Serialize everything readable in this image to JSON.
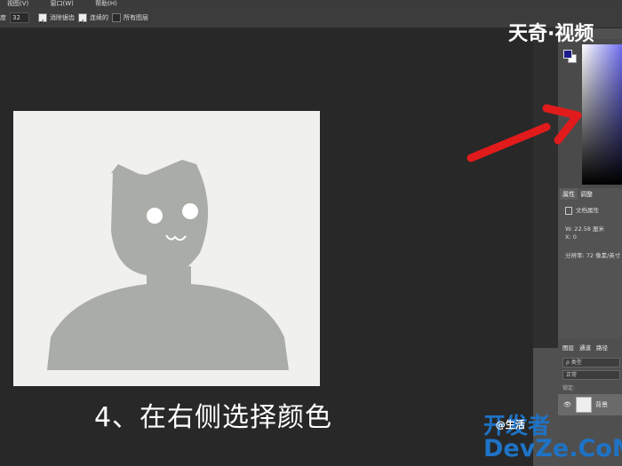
{
  "menubar": {
    "items": [
      "视图(V)",
      "窗口(W)",
      "帮助(H)"
    ]
  },
  "options": {
    "hardness_label": "度",
    "hardness_value": "32",
    "check1_label": "消除锯齿",
    "check2_label": "连续的",
    "check3_label": "所有图层"
  },
  "brand": "天奇·视频",
  "caption": "4、在右侧选择颜色",
  "colors": {
    "foreground": "#1d1a8a",
    "background": "#ffffff",
    "arrow": "#e11b1b",
    "figure": "#a9aca7"
  },
  "properties": {
    "tab_active": "属性",
    "tab_other": "调整",
    "section": "文档属性",
    "width": "W:  22.58 厘米",
    "x": "X:  0",
    "resolution": "分辨率: 72 像素/英寸"
  },
  "layers": {
    "tabs": [
      "图层",
      "通道",
      "路径"
    ],
    "search": "ρ 类型",
    "mode": "正常",
    "lock": "锁定:",
    "layer_name": "背景"
  },
  "watermark": {
    "top": "开发者",
    "overlay": "@生活",
    "bottom": "DevZe.CoM"
  }
}
